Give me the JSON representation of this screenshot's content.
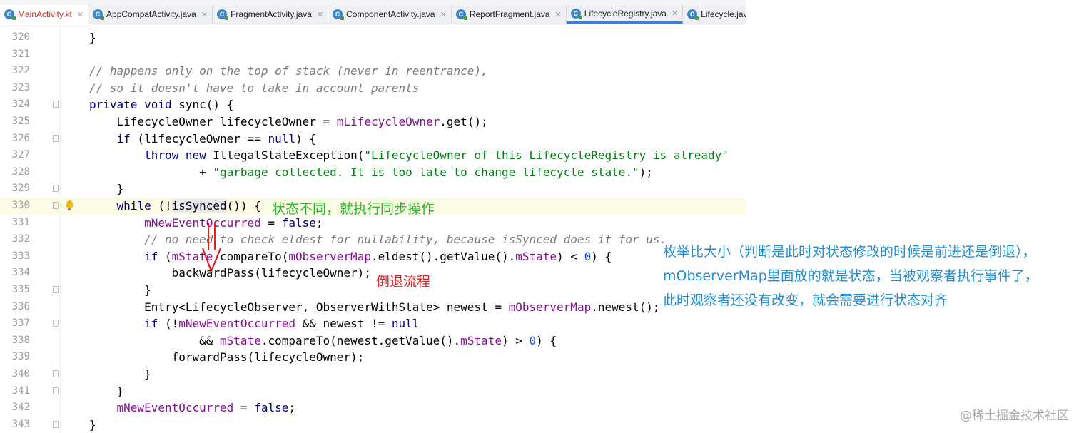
{
  "tabs": [
    {
      "label": "MainActivity.kt",
      "icon": "kotlin-file-icon",
      "active": true
    },
    {
      "label": "AppCompatActivity.java",
      "icon": "java-class-icon"
    },
    {
      "label": "FragmentActivity.java",
      "icon": "java-class-icon"
    },
    {
      "label": "ComponentActivity.java",
      "icon": "java-class-icon"
    },
    {
      "label": "ReportFragment.java",
      "icon": "java-class-icon"
    },
    {
      "label": "LifecycleRegistry.java",
      "icon": "java-class-icon",
      "selected": true
    },
    {
      "label": "Lifecycle.java",
      "icon": "java-class-icon"
    }
  ],
  "close_glyph": "✕",
  "lines": [
    {
      "n": "320",
      "t": "}"
    },
    {
      "n": "321",
      "t": ""
    },
    {
      "n": "322",
      "t": "// happens only on the top of stack (never in reentrance),"
    },
    {
      "n": "323",
      "t": "// so it doesn't have to take in account parents"
    },
    {
      "n": "324",
      "t": "private void sync() {"
    },
    {
      "n": "325",
      "t": "    LifecycleOwner lifecycleOwner = mLifecycleOwner.get();"
    },
    {
      "n": "326",
      "t": "    if (lifecycleOwner == null) {"
    },
    {
      "n": "327",
      "t": "        throw new IllegalStateException(\"LifecycleOwner of this LifecycleRegistry is already\""
    },
    {
      "n": "328",
      "t": "                + \"garbage collected. It is too late to change lifecycle state.\");"
    },
    {
      "n": "329",
      "t": "    }"
    },
    {
      "n": "330",
      "t": "    while (!isSynced()) {"
    },
    {
      "n": "331",
      "t": "        mNewEventOccurred = false;"
    },
    {
      "n": "332",
      "t": "        // no need to check eldest for nullability, because isSynced does it for us."
    },
    {
      "n": "333",
      "t": "        if (mState.compareTo(mObserverMap.eldest().getValue().mState) < 0) {"
    },
    {
      "n": "334",
      "t": "            backwardPass(lifecycleOwner);"
    },
    {
      "n": "335",
      "t": "        }"
    },
    {
      "n": "336",
      "t": "        Entry<LifecycleObserver, ObserverWithState> newest = mObserverMap.newest();"
    },
    {
      "n": "337",
      "t": "        if (!mNewEventOccurred && newest != null"
    },
    {
      "n": "338",
      "t": "                && mState.compareTo(newest.getValue().mState) > 0) {"
    },
    {
      "n": "339",
      "t": "            forwardPass(lifecycleOwner);"
    },
    {
      "n": "340",
      "t": "        }"
    },
    {
      "n": "341",
      "t": "    }"
    },
    {
      "n": "342",
      "t": "    mNewEventOccurred = false;"
    },
    {
      "n": "343",
      "t": "}"
    }
  ],
  "annotations": {
    "sync_note": "状态不同，就执行同步操作",
    "backward_note": "倒退流程",
    "compare_note": [
      "枚举比大小（判断是此时对状态修改的时候是前进还是倒退），",
      "mObserverMap里面放的就是状态，当被观察者执行事件了，",
      "此时观察者还没有改变，就会需要进行状态对齐"
    ]
  },
  "watermark": "@稀土掘金技术社区",
  "colors": {
    "keyword": "#000080",
    "comment": "#7a7a7a",
    "string": "#067d17",
    "field": "#871094",
    "number": "#1750eb",
    "annotation_green": "#2eb82e",
    "annotation_red": "#e02020",
    "annotation_blue": "#1f8ed6"
  }
}
